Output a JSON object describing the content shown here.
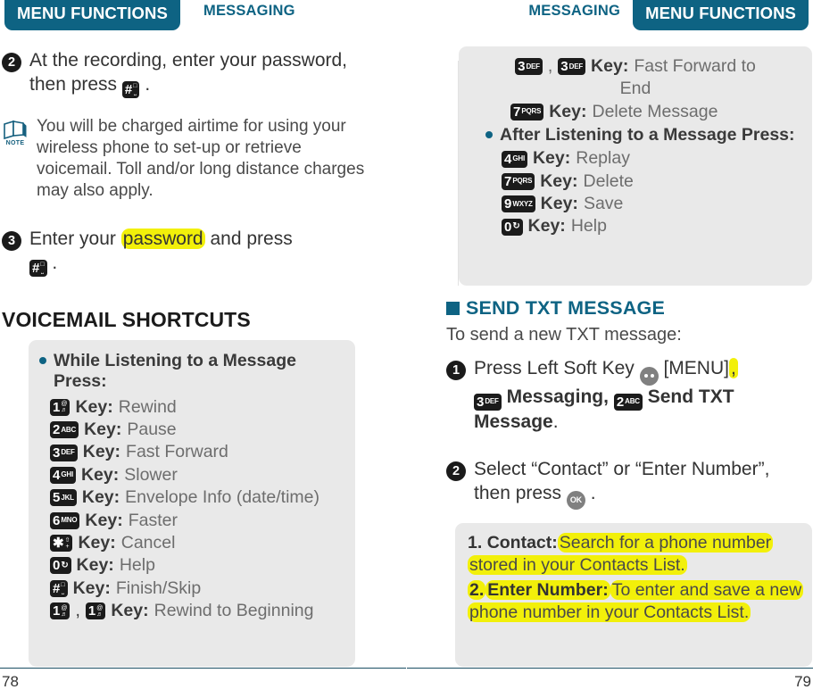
{
  "header": {
    "tab_label": "MENU FUNCTIONS",
    "kicker_label": "MESSAGING"
  },
  "left_page": {
    "folio": "78",
    "step2": {
      "number": "2",
      "text_before": "At the recording, enter your password, then press",
      "key": {
        "big": "#",
        "sub": "space"
      },
      "text_after": "."
    },
    "note": {
      "icon_label": "NOTE",
      "text": "You will be charged airtime for using your wireless phone to set-up or retrieve voicemail. Toll and/or long distance charges may also apply."
    },
    "step3": {
      "number": "3",
      "text_a": "Enter your",
      "highlight": "password",
      "text_b": "and press",
      "key": {
        "big": "#",
        "sub": "space"
      },
      "text_c": "."
    },
    "heading": "VOICEMAIL SHORTCUTS",
    "shortcut_box": {
      "bullet": "While Listening to a Message Press:",
      "rows": [
        {
          "keys": [
            {
              "big": "1",
              "sub": "@"
            }
          ],
          "label": "Key:",
          "value": "Rewind"
        },
        {
          "keys": [
            {
              "big": "2",
              "sub": "ABC"
            }
          ],
          "label": "Key:",
          "value": "Pause"
        },
        {
          "keys": [
            {
              "big": "3",
              "sub": "DEF"
            }
          ],
          "label": "Key:",
          "value": "Fast Forward"
        },
        {
          "keys": [
            {
              "big": "4",
              "sub": "GHI"
            }
          ],
          "label": "Key:",
          "value": "Slower"
        },
        {
          "keys": [
            {
              "big": "5",
              "sub": "JKL"
            }
          ],
          "label": "Key:",
          "value": "Envelope Info (date/time)"
        },
        {
          "keys": [
            {
              "big": "6",
              "sub": "MNO"
            }
          ],
          "label": "Key:",
          "value": "Faster"
        },
        {
          "keys": [
            {
              "big": "✱",
              "sub": "shift"
            }
          ],
          "label": "Key:",
          "value": "Cancel"
        },
        {
          "keys": [
            {
              "big": "0",
              "sub": "↻"
            }
          ],
          "label": "Key:",
          "value": "Help"
        },
        {
          "keys": [
            {
              "big": "#",
              "sub": "space"
            }
          ],
          "label": "Key:",
          "value": "Finish/Skip"
        },
        {
          "keys": [
            {
              "big": "1",
              "sub": "@"
            },
            {
              "big": "1",
              "sub": "@"
            }
          ],
          "separator": ",",
          "label": "Key:",
          "value": "Rewind to Beginning"
        }
      ]
    }
  },
  "right_page": {
    "folio": "79",
    "shortcut_box": {
      "rows": [
        {
          "keys": [
            {
              "big": "3",
              "sub": "DEF"
            },
            {
              "big": "3",
              "sub": "DEF"
            }
          ],
          "separator": ",",
          "label": "Key:",
          "value": "Fast Forward to"
        },
        {
          "continuation": "End"
        },
        {
          "keys": [
            {
              "big": "7",
              "sub": "PQRS"
            }
          ],
          "label": "Key:",
          "value": "Delete Message"
        }
      ],
      "bullet": "After Listening to a Message Press:",
      "rows2": [
        {
          "keys": [
            {
              "big": "4",
              "sub": "GHI"
            }
          ],
          "label": "Key:",
          "value": "Replay"
        },
        {
          "keys": [
            {
              "big": "7",
              "sub": "PQRS"
            }
          ],
          "label": "Key:",
          "value": "Delete"
        },
        {
          "keys": [
            {
              "big": "9",
              "sub": "WXYZ"
            }
          ],
          "label": "Key:",
          "value": "Save"
        },
        {
          "keys": [
            {
              "big": "0",
              "sub": "↻"
            }
          ],
          "label": "Key:",
          "value": "Help"
        }
      ]
    },
    "heading": "SEND TXT MESSAGE",
    "intro": "To send a new TXT message:",
    "step1": {
      "number": "1",
      "text_a": "Press Left Soft Key",
      "softkey": "dots",
      "text_b": "[MENU]",
      "highlight_comma": ",",
      "key1": {
        "big": "3",
        "sub": "DEF"
      },
      "text_c": "Messaging,",
      "key2": {
        "big": "2",
        "sub": "ABC"
      },
      "text_d": "Send TXT Message",
      "text_e": "."
    },
    "step2": {
      "number": "2",
      "text_a": "Select “Contact” or “Enter Number”, then press",
      "softkey": "ok",
      "text_b": "."
    },
    "option_box": {
      "items": [
        {
          "num": "1.",
          "term": "Contact:",
          "desc": "Search for a phone number stored in your Contacts List."
        },
        {
          "num": "2.",
          "term": "Enter Number:",
          "desc": "To enter and save a new phone number in your Contacts List."
        }
      ]
    }
  },
  "colors": {
    "teal": "#0e6383",
    "highlight": "#f2f00a",
    "graybox": "#e9e9e9",
    "keycap": "#1b1b1b"
  }
}
